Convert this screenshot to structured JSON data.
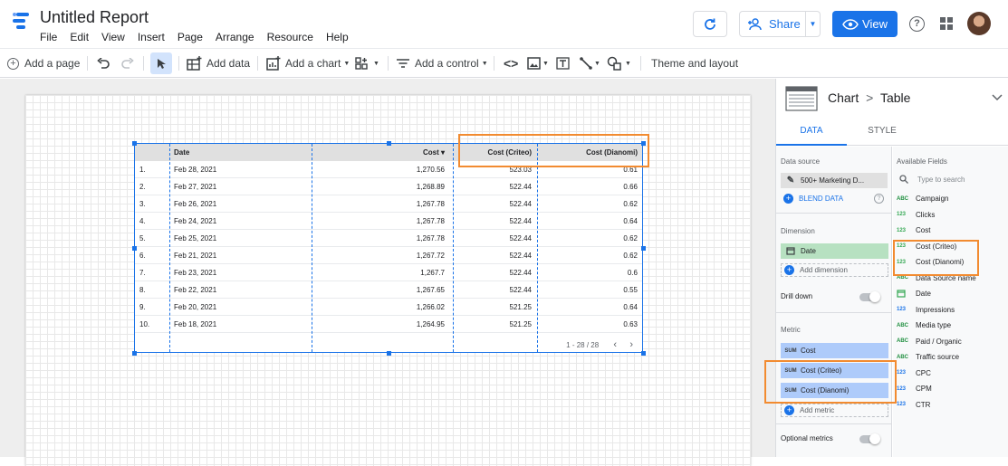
{
  "app": {
    "title": "Untitled Report",
    "menu": [
      "File",
      "Edit",
      "View",
      "Insert",
      "Page",
      "Arrange",
      "Resource",
      "Help"
    ],
    "share_label": "Share",
    "view_label": "View"
  },
  "toolbar": {
    "add_page": "Add a page",
    "add_data": "Add data",
    "add_chart": "Add a chart",
    "add_control": "Add a control",
    "theme_layout": "Theme and layout"
  },
  "table": {
    "headers": [
      "Date",
      "Cost ▾",
      "Cost (Criteo)",
      "Cost (Dianomi)"
    ],
    "rows": [
      {
        "n": "1.",
        "date": "Feb 28, 2021",
        "cost": "1,270.56",
        "criteo": "523.03",
        "dianomi": "0.61"
      },
      {
        "n": "2.",
        "date": "Feb 27, 2021",
        "cost": "1,268.89",
        "criteo": "522.44",
        "dianomi": "0.66"
      },
      {
        "n": "3.",
        "date": "Feb 26, 2021",
        "cost": "1,267.78",
        "criteo": "522.44",
        "dianomi": "0.62"
      },
      {
        "n": "4.",
        "date": "Feb 24, 2021",
        "cost": "1,267.78",
        "criteo": "522.44",
        "dianomi": "0.64"
      },
      {
        "n": "5.",
        "date": "Feb 25, 2021",
        "cost": "1,267.78",
        "criteo": "522.44",
        "dianomi": "0.62"
      },
      {
        "n": "6.",
        "date": "Feb 21, 2021",
        "cost": "1,267.72",
        "criteo": "522.44",
        "dianomi": "0.62"
      },
      {
        "n": "7.",
        "date": "Feb 23, 2021",
        "cost": "1,267.7",
        "criteo": "522.44",
        "dianomi": "0.6"
      },
      {
        "n": "8.",
        "date": "Feb 22, 2021",
        "cost": "1,267.65",
        "criteo": "522.44",
        "dianomi": "0.55"
      },
      {
        "n": "9.",
        "date": "Feb 20, 2021",
        "cost": "1,266.02",
        "criteo": "521.25",
        "dianomi": "0.64"
      },
      {
        "n": "10.",
        "date": "Feb 18, 2021",
        "cost": "1,264.95",
        "criteo": "521.25",
        "dianomi": "0.63"
      }
    ],
    "pagination": "1 - 28 / 28"
  },
  "panel": {
    "chart_label": "Chart",
    "chart_type": "Table",
    "tab_data": "DATA",
    "tab_style": "STYLE",
    "data_source_label": "Data source",
    "data_source_value": "500+ Marketing D...",
    "blend_data": "BLEND DATA",
    "dimension_label": "Dimension",
    "dimension_value": "Date",
    "add_dimension": "Add dimension",
    "drill_down": "Drill down",
    "metric_label": "Metric",
    "metrics": [
      {
        "tag": "SUM",
        "name": "Cost"
      },
      {
        "tag": "SUM",
        "name": "Cost (Criteo)"
      },
      {
        "tag": "SUM",
        "name": "Cost (Dianomi)"
      }
    ],
    "add_metric": "Add metric",
    "optional_metrics": "Optional metrics",
    "available_fields_label": "Available Fields",
    "search_placeholder": "Type to search",
    "fields": [
      {
        "type": "ABC",
        "name": "Campaign"
      },
      {
        "type": "123",
        "name": "Clicks"
      },
      {
        "type": "123",
        "name": "Cost"
      },
      {
        "type": "123",
        "name": "Cost (Criteo)"
      },
      {
        "type": "123",
        "name": "Cost (Dianomi)"
      },
      {
        "type": "ABC",
        "name": "Data Source name"
      },
      {
        "type": "date",
        "name": "Date"
      },
      {
        "type": "123",
        "name": "Impressions"
      },
      {
        "type": "ABC",
        "name": "Media type"
      },
      {
        "type": "ABC",
        "name": "Paid / Organic"
      },
      {
        "type": "ABC",
        "name": "Traffic source"
      },
      {
        "type": "123",
        "name": "CPC"
      },
      {
        "type": "123",
        "name": "CPM"
      },
      {
        "type": "123",
        "name": "CTR"
      }
    ]
  },
  "colors": {
    "accent": "#1a73e8",
    "highlight": "#f28b30",
    "dimension_chip": "#b7e1c1",
    "metric_chip": "#aecbfa"
  }
}
